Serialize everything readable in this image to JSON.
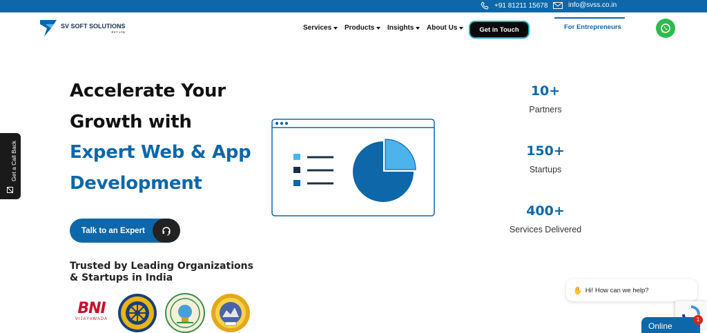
{
  "topbar": {
    "phone": "+91 81211 15678",
    "email": "info@svss.co.in"
  },
  "logo": {
    "name": "SV SOFT SOLUTIONS",
    "sub": "PVT LTD"
  },
  "nav": {
    "items": [
      "Services",
      "Products",
      "Insights",
      "About Us"
    ],
    "cta": "Get in Touch",
    "entrepreneurs": "For Entrepreneurs"
  },
  "hero": {
    "line1": "Accelerate Your",
    "line2": "Growth with",
    "line3": "Expert Web & App",
    "line4": "Development",
    "button": "Talk to an Expert"
  },
  "trusted": "Trusted by Leading Organizations & Startups in India",
  "logos": {
    "bni": "BNI",
    "bni_sub": "VIJAYAWADA"
  },
  "stats": [
    {
      "value": "10+",
      "label": "Partners"
    },
    {
      "value": "150+",
      "label": "Startups"
    },
    {
      "value": "400+",
      "label": "Services Delivered"
    }
  ],
  "callback": "Get a Call Back",
  "chat": {
    "greeting": "Hi! How can we help?",
    "status": "Online",
    "badge": "1"
  },
  "colors": {
    "brand_blue": "#0d67a8",
    "light_blue": "#4db3ec",
    "whatsapp_green": "#2cbb4b"
  }
}
